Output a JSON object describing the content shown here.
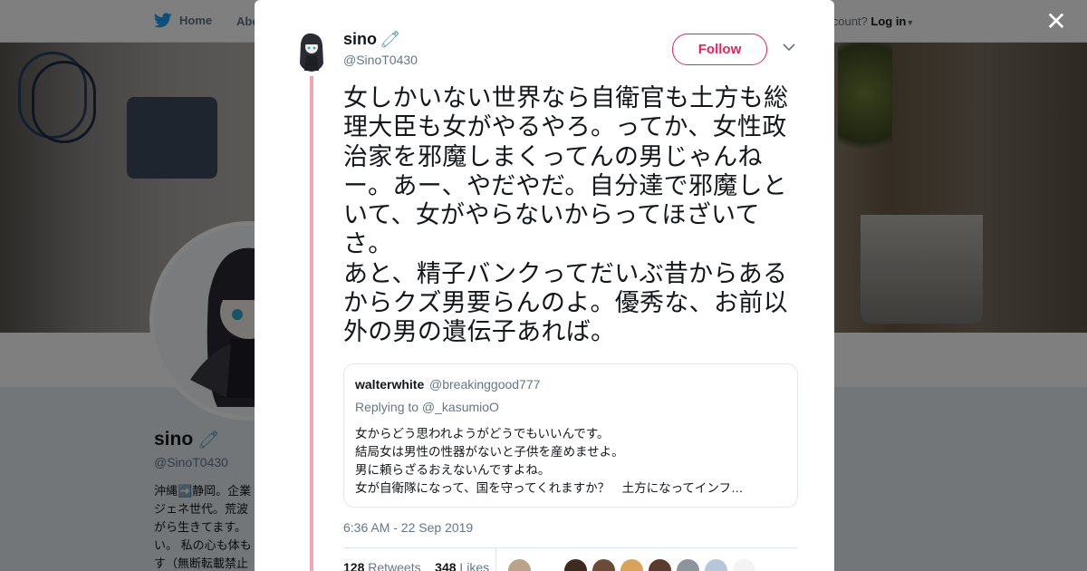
{
  "nav": {
    "home_label": "Home",
    "about_label": "Abo",
    "account_prompt": "account?",
    "login_label": "Log in"
  },
  "background_profile": {
    "name": "sino",
    "handle": "@SinoT0430",
    "bio": "沖縄➡️静岡。企業\nジェネ世代。荒波\nがら生きてます。\nい。 私の心も体も\nす（無断転載禁止"
  },
  "tweet": {
    "author_name": "sino",
    "author_handle": "@SinoT0430",
    "follow_label": "Follow",
    "text": "女しかいない世界なら自衛官も土方も総理大臣も女がやるやろ。ってか、女性政治家を邪魔しまくってんの男じゃんねー。あー、やだやだ。自分達で邪魔しといて、女がやらないからってほざいてさ。\nあと、精子バンクってだいぶ昔からあるからクズ男要らんのよ。優秀な、お前以外の男の遺伝子あれば。",
    "timestamp": "6:36 AM - 22 Sep 2019",
    "retweets_count": "128",
    "retweets_label": "Retweets",
    "likes_count": "348",
    "likes_label": "Likes"
  },
  "quoted_tweet": {
    "author_name": "walterwhite",
    "author_handle": "@breakinggood777",
    "replying_to": "Replying to @_kasumioO",
    "text": "女からどう思われようがどうでもいいんです。\n結局女は男性の性器がないと子供を産めませよ。\n男に頼らざるおえないんですよね。\n女が自衛隊になって、国を守ってくれますか？　土方になってインフ…"
  },
  "colors": {
    "follow_accent": "#e0245e",
    "thread_line": "#f0a6b4",
    "secondary_text": "#657786",
    "twitter_blue": "#1da1f2"
  },
  "liker_colors": [
    "#b9a48a",
    "#ffffff",
    "#3d2b1f",
    "#6b4a3a",
    "#d9a35c",
    "#5a3b2e",
    "#8d949c",
    "#b7c6d8",
    "#f3f3f3"
  ]
}
